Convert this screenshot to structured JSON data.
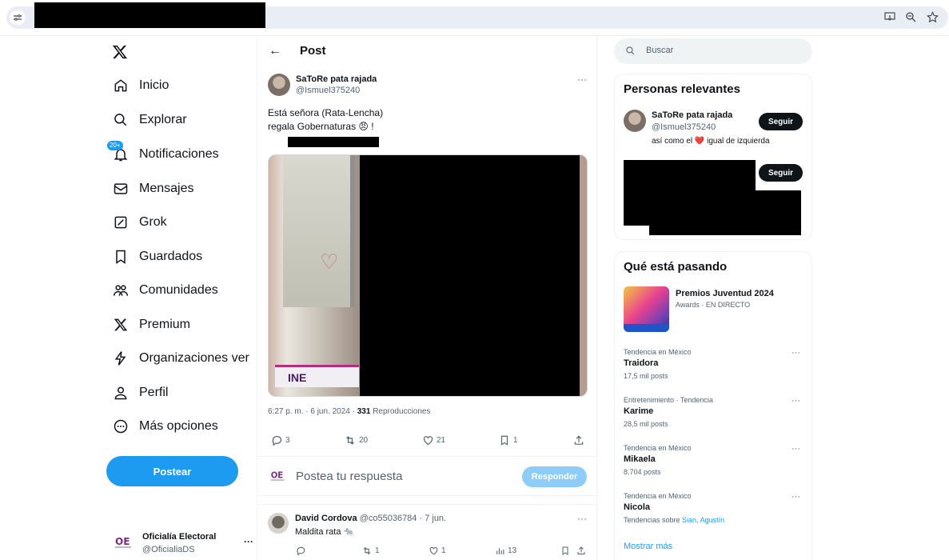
{
  "nav": {
    "items": [
      {
        "label": "Inicio",
        "icon": "home-icon"
      },
      {
        "label": "Explorar",
        "icon": "search-icon"
      },
      {
        "label": "Notificaciones",
        "icon": "bell-icon",
        "badge": "20+"
      },
      {
        "label": "Mensajes",
        "icon": "mail-icon"
      },
      {
        "label": "Grok",
        "icon": "grok-icon"
      },
      {
        "label": "Guardados",
        "icon": "bookmark-icon"
      },
      {
        "label": "Comunidades",
        "icon": "people-icon"
      },
      {
        "label": "Premium",
        "icon": "x-logo-icon"
      },
      {
        "label": "Organizaciones ver",
        "icon": "lightning-icon"
      },
      {
        "label": "Perfil",
        "icon": "person-icon"
      },
      {
        "label": "Más opciones",
        "icon": "more-circle-icon"
      }
    ],
    "post_button": "Postear",
    "account": {
      "name": "Oficialía Electoral",
      "handle": "@OficialiaDS",
      "more": "···"
    }
  },
  "main": {
    "title": "Post",
    "tweet": {
      "author": "SaToRe pata rajada",
      "handle": "@Ismuel375240",
      "more": "···",
      "text_line1": "Está señora (Rata-Lencha)",
      "text_line2": "regala Gobernaturas 😠 !",
      "media_label": "INE",
      "time": "6:27 p. m. · 6 jun. 2024 · ",
      "views_count": "331",
      "views_label": " Reproducciones",
      "replies": "3",
      "retweets": "20",
      "likes": "21",
      "bookmarks": "1"
    },
    "reply_placeholder": "Postea tu respuesta",
    "reply_button": "Responder",
    "reply": {
      "author": "David Cordova",
      "meta": " @co55036784 · 7 jun.",
      "text": "Maldita rata 🐀",
      "more": "···",
      "retweets": "1",
      "likes": "1",
      "views": "13"
    }
  },
  "sidebar": {
    "search_placeholder": "Buscar",
    "relevant": {
      "title": "Personas relevantes",
      "person": {
        "name": "SaToRe pata rajada",
        "handle": "@Ismuel375240",
        "bio": "así como el ❤️ igual de izquierda"
      },
      "follow_label": "Seguir"
    },
    "happening": {
      "title": "Qué está pasando",
      "featured": {
        "title": "Premios Juventud 2024",
        "sub": "Awards · EN DIRECTO"
      },
      "trends": [
        {
          "category": "Tendencia en México",
          "name": "Traidora",
          "posts": "17,5 mil posts"
        },
        {
          "category": "Entretenimiento · Tendencia",
          "name": "Karime",
          "posts": "28,5 mil posts"
        },
        {
          "category": "Tendencia en México",
          "name": "Mikaela",
          "posts": "8.704 posts"
        },
        {
          "category": "Tendencia en México",
          "name": "Nicola",
          "posts_prefix": "Tendencias sobre ",
          "posts_links": "Sian, Agustín"
        }
      ],
      "show_more": "Mostrar más"
    }
  },
  "colors": {
    "accent": "#1d9bf0",
    "text": "#0f1419",
    "muted": "#536471"
  }
}
